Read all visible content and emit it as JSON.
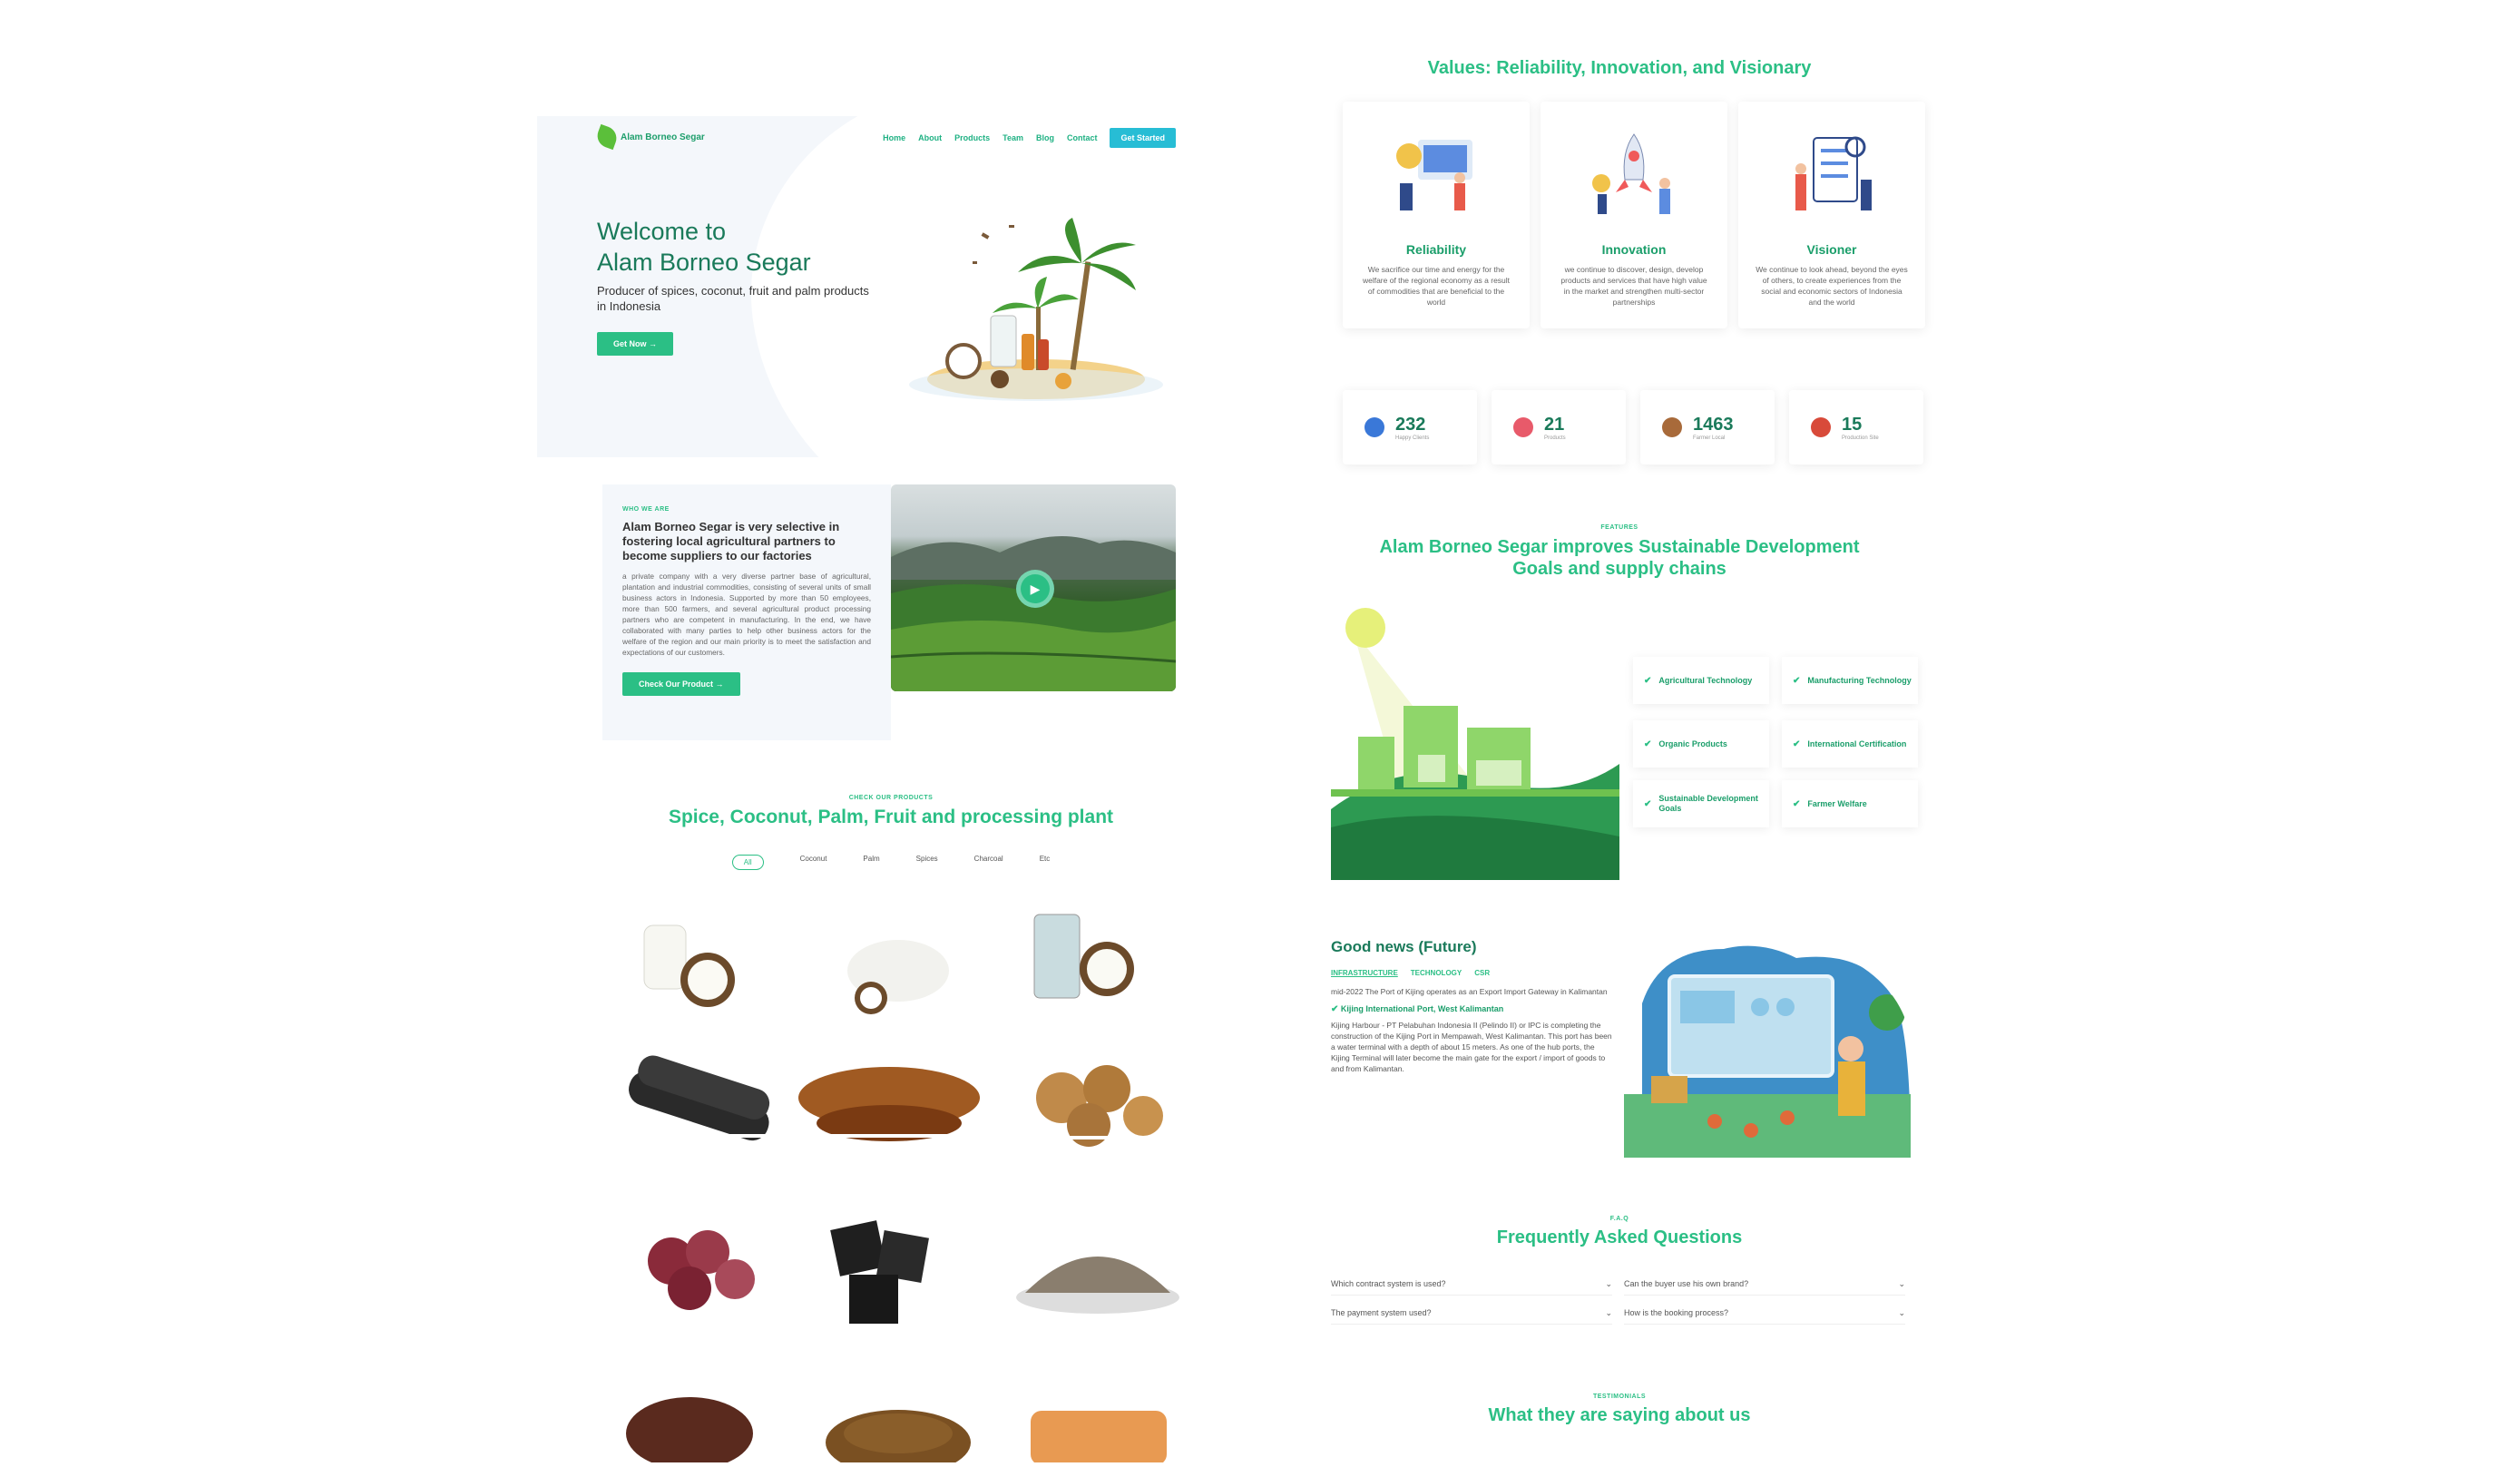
{
  "hero": {
    "logo_text": "Alam Borneo Segar",
    "nav": [
      "Home",
      "About",
      "Products",
      "Team",
      "Blog",
      "Contact"
    ],
    "nav_cta": "Get Started",
    "title_line1": "Welcome to",
    "title_line2": "Alam Borneo Segar",
    "subtitle": "Producer of spices, coconut, fruit and palm products in Indonesia",
    "cta": "Get Now →"
  },
  "about": {
    "eyebrow": "WHO WE ARE",
    "heading": "Alam Borneo Segar is very selective in fostering local agricultural partners to become suppliers to our factories",
    "body": "a private company with a very diverse partner base of agricultural, plantation and industrial commodities, consisting of several units of small business actors in Indonesia. Supported by more than 50 employees, more than 500 farmers, and several agricultural product processing partners who are competent in manufacturing. In the end, we have collaborated with many parties to help other business actors for the welfare of the region and our main priority is to meet the satisfaction and expectations of our customers.",
    "cta": "Check Our Product →"
  },
  "products": {
    "eyebrow": "CHECK OUR PRODUCTS",
    "heading": "Spice, Coconut, Palm, Fruit and processing plant",
    "filters": [
      "All",
      "Coconut",
      "Palm",
      "Spices",
      "Charcoal",
      "Etc"
    ]
  },
  "values": {
    "heading": "Values: Reliability, Innovation, and Visionary",
    "items": [
      {
        "title": "Reliability",
        "text": "We sacrifice our time and energy for the welfare of the regional economy as a result of commodities that are beneficial to the world"
      },
      {
        "title": "Innovation",
        "text": "we continue to discover, design, develop products and services that have high value in the market and strengthen multi-sector partnerships"
      },
      {
        "title": "Visioner",
        "text": "We continue to look ahead, beyond the eyes of others, to create experiences from the social and economic sectors of Indonesia and the world"
      }
    ]
  },
  "stats": [
    {
      "num": "232",
      "label": "Happy Clients"
    },
    {
      "num": "21",
      "label": "Products"
    },
    {
      "num": "1463",
      "label": "Farmer Local"
    },
    {
      "num": "15",
      "label": "Production Site"
    }
  ],
  "features": {
    "eyebrow": "FEATURES",
    "heading_line1": "Alam Borneo Segar improves Sustainable Development",
    "heading_line2": "Goals and supply chains",
    "items": [
      "Agricultural Technology",
      "Manufacturing Technology",
      "Organic Products",
      "International Certification",
      "Sustainable Development Goals",
      "Farmer Welfare"
    ]
  },
  "news": {
    "heading": "Good news (Future)",
    "tabs": [
      "INFRASTRUCTURE",
      "TECHNOLOGY",
      "CSR"
    ],
    "intro": "mid-2022 The Port of Kijing operates as an Export Import Gateway in Kalimantan",
    "item_title": "Kijing International Port, West Kalimantan",
    "item_text": "Kijing Harbour - PT Pelabuhan Indonesia II (Pelindo II) or IPC is completing the construction of the Kijing Port in Mempawah, West Kalimantan. This port has been a water terminal with a depth of about 15 meters. As one of the hub ports, the Kijing Terminal will later become the main gate for the export / import of goods to and from Kalimantan."
  },
  "faq": {
    "eyebrow": "F.A.Q",
    "heading": "Frequently Asked Questions",
    "items": [
      "Which contract system is used?",
      "Can the buyer use his own brand?",
      "The payment system used?",
      "How is the booking process?"
    ]
  },
  "testimonials": {
    "eyebrow": "TESTIMONIALS",
    "heading": "What they are saying about us"
  },
  "colors": {
    "accent": "#2bbf85",
    "dark_green": "#1a7a5a",
    "cyan": "#27bdd5"
  }
}
